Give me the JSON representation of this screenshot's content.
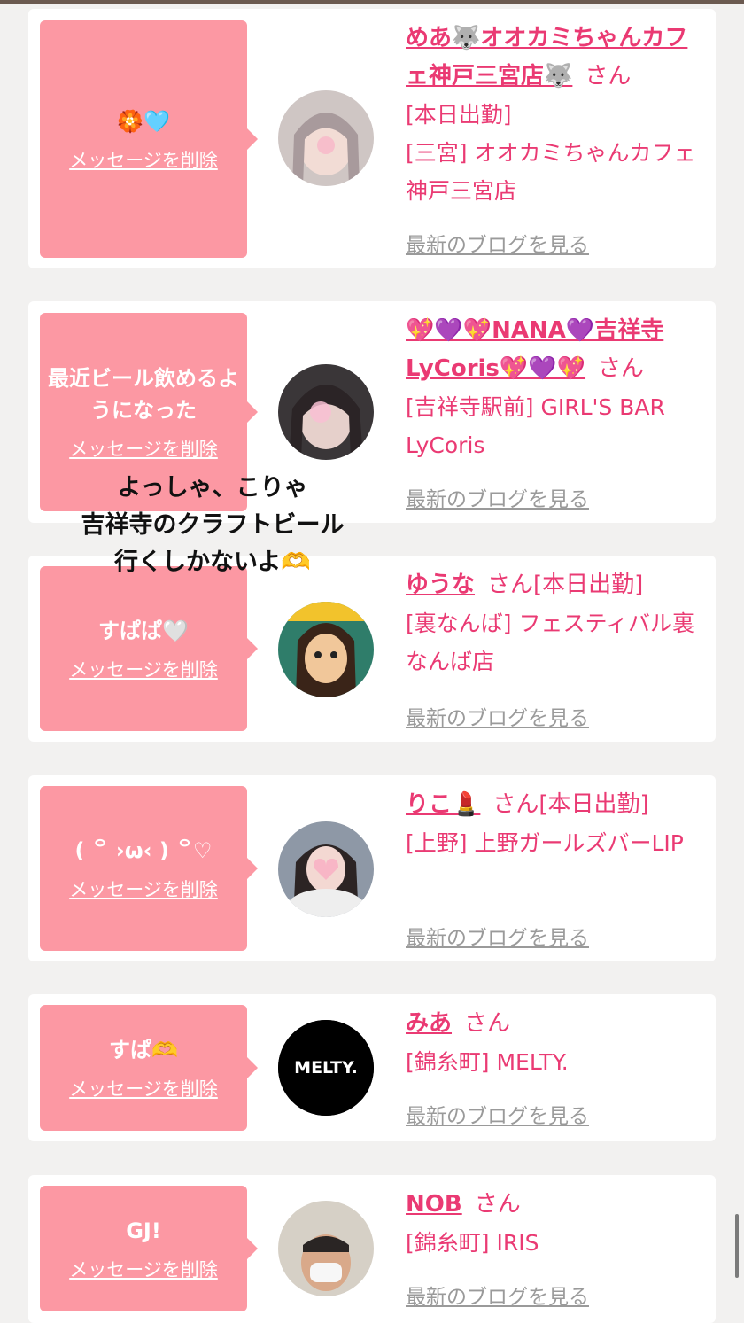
{
  "delete_label": "メッセージを削除",
  "blog_label": "最新のブログを見る",
  "san": "さん",
  "cards": [
    {
      "message": "🏵️🩵",
      "name": "めあ🐺オオカミちゃんカフェ神戸三宮店🐺",
      "attendance": "",
      "lines": [
        "[本日出勤]",
        "[三宮] オオカミちゃんカフェ神戸三宮店"
      ]
    },
    {
      "message": "最近ビール飲めるようになった",
      "name": "💖💜💖NANA💜吉祥寺LyCoris💖💜💖",
      "attendance": "",
      "lines": [
        "[吉祥寺駅前] GIRL'S BAR LyCoris"
      ]
    },
    {
      "message": "すぱぱ🤍",
      "name": "ゆうな",
      "attendance": "[本日出勤]",
      "lines": [
        "[裏なんば] フェスティバル裏なんば店"
      ]
    },
    {
      "message": "( ꒪ ›ω‹ ) ꒪♡",
      "name": "りこ💄",
      "attendance": "[本日出勤]",
      "lines": [
        "[上野] 上野ガールズバーLIP"
      ]
    },
    {
      "message": "すぱ🫶",
      "name": "みあ",
      "attendance": "",
      "lines": [
        "[錦糸町] MELTY."
      ]
    },
    {
      "message": "GJ!",
      "name": "NOB",
      "attendance": "",
      "lines": [
        "[錦糸町] IRIS"
      ]
    }
  ],
  "avatar_text": "MELTY.",
  "overlay_text": [
    "よっしゃ、こりゃ",
    "吉祥寺のクラフトビール",
    "行くしかないよ🫶"
  ]
}
